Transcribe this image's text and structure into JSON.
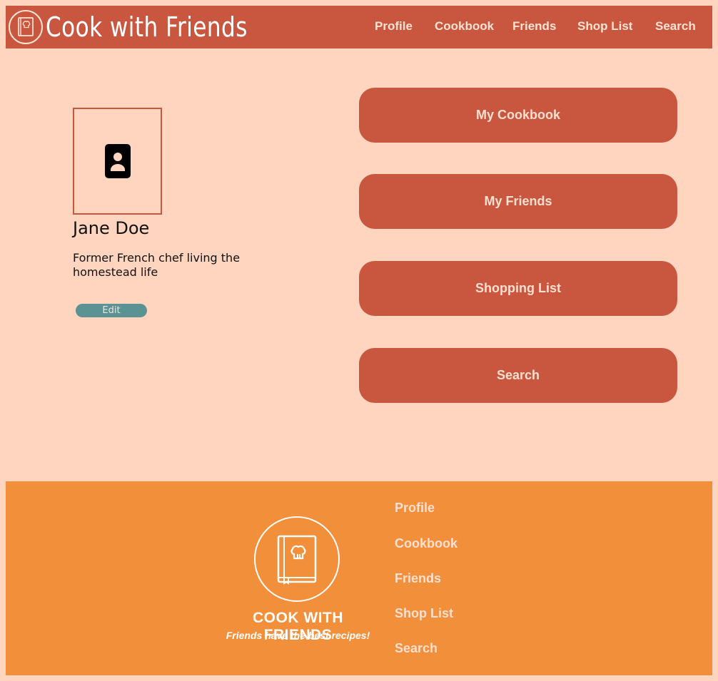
{
  "header": {
    "title": "Cook with Friends",
    "nav": [
      "Profile",
      "Cookbook",
      "Friends",
      "Shop List",
      "Search"
    ]
  },
  "profile": {
    "name": "Jane Doe",
    "bio": "Former French chef living the homestead life",
    "edit_label": "Edit"
  },
  "actions": [
    "My Cookbook",
    "My Friends",
    "Shopping List",
    "Search"
  ],
  "footer": {
    "brand": "COOK WITH FRIENDS",
    "tagline": "Friends have the best recipes!",
    "links": [
      "Profile",
      "Cookbook",
      "Friends",
      "Shop List",
      "Search"
    ]
  },
  "colors": {
    "background": "#FFD5BF",
    "primary": "#C9563F",
    "footer": "#F28F3B",
    "edit_button": "#5B9293"
  },
  "icons": {
    "logo": "cookbook-chef-hat-icon",
    "avatar": "contact-person-icon"
  }
}
